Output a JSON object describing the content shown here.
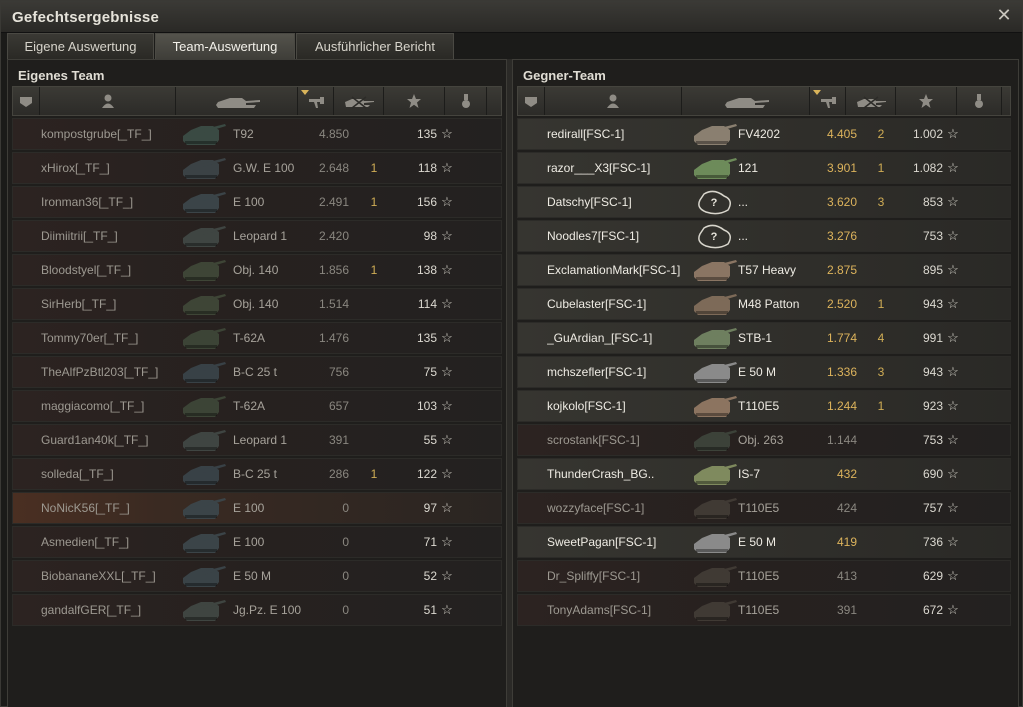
{
  "window": {
    "title": "Gefechtsergebnisse"
  },
  "tabs": [
    {
      "label": "Eigene Auswertung",
      "active": false
    },
    {
      "label": "Team-Auswertung",
      "active": true
    },
    {
      "label": "Ausführlicher Bericht",
      "active": false
    }
  ],
  "columns": {
    "icons": [
      "platoon-icon",
      "player-icon",
      "tank-icon",
      "damage-icon",
      "kills-icon",
      "xp-star-icon",
      "medal-icon"
    ],
    "sorted": "damage"
  },
  "own_team": {
    "title": "Eigenes Team",
    "rows": [
      {
        "name": "kompostgrube[_TF_]",
        "vehicle": "T92",
        "damage": "4.850",
        "kills": "",
        "xp": "135",
        "state": "dead",
        "tank_color": "#3a4a43"
      },
      {
        "name": "xHirox[_TF_]",
        "vehicle": "G.W. E 100",
        "damage": "2.648",
        "kills": "1",
        "xp": "118",
        "state": "dead",
        "tank_color": "#3b4245"
      },
      {
        "name": "Ironman36[_TF_]",
        "vehicle": "E 100",
        "damage": "2.491",
        "kills": "1",
        "xp": "156",
        "state": "dead",
        "tank_color": "#3b4448"
      },
      {
        "name": "Diimiitrii[_TF_]",
        "vehicle": "Leopard 1",
        "damage": "2.420",
        "kills": "",
        "xp": "98",
        "state": "dead",
        "tank_color": "#3f4542"
      },
      {
        "name": "Bloodstyel[_TF_]",
        "vehicle": "Obj. 140",
        "damage": "1.856",
        "kills": "1",
        "xp": "138",
        "state": "dead",
        "tank_color": "#3e4536"
      },
      {
        "name": "SirHerb[_TF_]",
        "vehicle": "Obj. 140",
        "damage": "1.514",
        "kills": "",
        "xp": "114",
        "state": "dead",
        "tank_color": "#3e4536"
      },
      {
        "name": "Tommy70er[_TF_]",
        "vehicle": "T-62A",
        "damage": "1.476",
        "kills": "",
        "xp": "135",
        "state": "dead",
        "tank_color": "#3c4436"
      },
      {
        "name": "TheAlfPzBtl203[_TF_]",
        "vehicle": "B-C 25 t",
        "damage": "756",
        "kills": "",
        "xp": "75",
        "state": "dead",
        "tank_color": "#384146"
      },
      {
        "name": "maggiacomo[_TF_]",
        "vehicle": "T-62A",
        "damage": "657",
        "kills": "",
        "xp": "103",
        "state": "dead",
        "tank_color": "#3c4436"
      },
      {
        "name": "Guard1an40k[_TF_]",
        "vehicle": "Leopard 1",
        "damage": "391",
        "kills": "",
        "xp": "55",
        "state": "dead",
        "tank_color": "#3f4542"
      },
      {
        "name": "solleda[_TF_]",
        "vehicle": "B-C 25 t",
        "damage": "286",
        "kills": "1",
        "xp": "122",
        "state": "dead",
        "tank_color": "#384146"
      },
      {
        "name": "NoNicK56[_TF_]",
        "vehicle": "E 100",
        "damage": "0",
        "kills": "",
        "xp": "97",
        "state": "self",
        "tank_color": "#3b4448"
      },
      {
        "name": "Asmedien[_TF_]",
        "vehicle": "E 100",
        "damage": "0",
        "kills": "",
        "xp": "71",
        "state": "dead",
        "tank_color": "#3b4448"
      },
      {
        "name": "BiobananeXXL[_TF_]",
        "vehicle": "E 50 M",
        "damage": "0",
        "kills": "",
        "xp": "52",
        "state": "dead",
        "tank_color": "#3a4347"
      },
      {
        "name": "gandalfGER[_TF_]",
        "vehicle": "Jg.Pz. E 100",
        "damage": "0",
        "kills": "",
        "xp": "51",
        "state": "dead",
        "tank_color": "#3f4541"
      }
    ]
  },
  "enemy_team": {
    "title": "Gegner-Team",
    "rows": [
      {
        "name": "redirall[FSC-1]",
        "vehicle": "FV4202",
        "damage": "4.405",
        "kills": "2",
        "xp": "1.002",
        "state": "alive",
        "tank_color": "#8a7f70"
      },
      {
        "name": "razor___X3[FSC-1]",
        "vehicle": "121",
        "damage": "3.901",
        "kills": "1",
        "xp": "1.082",
        "state": "alive",
        "tank_color": "#6d8b5a"
      },
      {
        "name": "Datschy[FSC-1]",
        "vehicle": "...",
        "damage": "3.620",
        "kills": "3",
        "xp": "853",
        "state": "alive",
        "tank_color": "unknown"
      },
      {
        "name": "Noodles7[FSC-1]",
        "vehicle": "...",
        "damage": "3.276",
        "kills": "",
        "xp": "753",
        "state": "alive",
        "tank_color": "unknown"
      },
      {
        "name": "ExclamationMark[FSC-1]",
        "vehicle": "T57 Heavy",
        "damage": "2.875",
        "kills": "",
        "xp": "895",
        "state": "alive",
        "tank_color": "#8a7563"
      },
      {
        "name": "Cubelaster[FSC-1]",
        "vehicle": "M48 Patton",
        "damage": "2.520",
        "kills": "1",
        "xp": "943",
        "state": "alive",
        "tank_color": "#7d6a58"
      },
      {
        "name": "_GuArdian_[FSC-1]",
        "vehicle": "STB-1",
        "damage": "1.774",
        "kills": "4",
        "xp": "991",
        "state": "alive",
        "tank_color": "#6e7f5f"
      },
      {
        "name": "mchszefler[FSC-1]",
        "vehicle": "E 50 M",
        "damage": "1.336",
        "kills": "3",
        "xp": "943",
        "state": "alive",
        "tank_color": "#8a8a8a"
      },
      {
        "name": "kojkolo[FSC-1]",
        "vehicle": "T110E5",
        "damage": "1.244",
        "kills": "1",
        "xp": "923",
        "state": "alive",
        "tank_color": "#8c7460"
      },
      {
        "name": "scrostank[FSC-1]",
        "vehicle": "Obj. 263",
        "damage": "1.144",
        "kills": "",
        "xp": "753",
        "state": "dead",
        "tank_color": "#3c4239"
      },
      {
        "name": "ThunderCrash_BG..",
        "vehicle": "IS-7",
        "damage": "432",
        "kills": "",
        "xp": "690",
        "state": "alive",
        "tank_color": "#7f8a5e"
      },
      {
        "name": "wozzyface[FSC-1]",
        "vehicle": "T110E5",
        "damage": "424",
        "kills": "",
        "xp": "757",
        "state": "dead",
        "tank_color": "#403a34"
      },
      {
        "name": "SweetPagan[FSC-1]",
        "vehicle": "E 50 M",
        "damage": "419",
        "kills": "",
        "xp": "736",
        "state": "alive",
        "tank_color": "#8a8a8a"
      },
      {
        "name": "Dr_Spliffy[FSC-1]",
        "vehicle": "T110E5",
        "damage": "413",
        "kills": "",
        "xp": "629",
        "state": "dead",
        "tank_color": "#403a34"
      },
      {
        "name": "TonyAdams[FSC-1]",
        "vehicle": "T110E5",
        "damage": "391",
        "kills": "",
        "xp": "672",
        "state": "dead",
        "tank_color": "#403a34"
      }
    ]
  },
  "star_glyph": "☆",
  "close_glyph": "✕"
}
